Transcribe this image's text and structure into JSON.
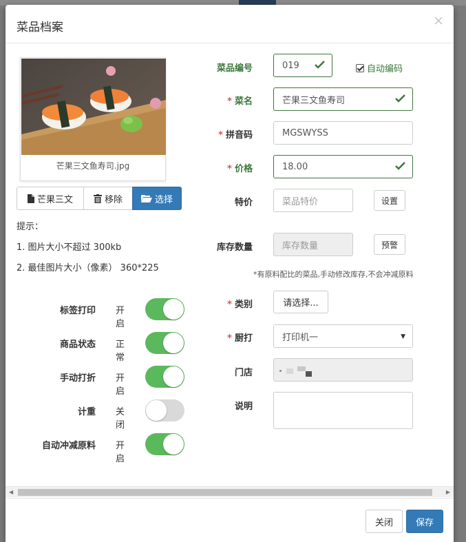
{
  "modal": {
    "title": "菜品档案",
    "close_symbol": "×"
  },
  "image": {
    "caption": "芒果三文鱼寿司.jpg"
  },
  "image_buttons": {
    "name_label": "芒果三文",
    "remove_label": "移除",
    "choose_label": "选择"
  },
  "tips": {
    "heading": "提示：",
    "items": [
      "1. 图片大小不超过 300kb",
      "2. 最佳图片大小（像素） 360*225"
    ]
  },
  "toggles": [
    {
      "label": "标签打印",
      "state": "开启",
      "on": true
    },
    {
      "label": "商品状态",
      "state": "正常",
      "on": true
    },
    {
      "label": "手动打折",
      "state": "开启",
      "on": true
    },
    {
      "label": "计重",
      "state": "关闭",
      "on": false
    },
    {
      "label": "自动冲减原料",
      "state": "开启",
      "on": true
    }
  ],
  "form": {
    "code": {
      "label": "菜品编号",
      "value": "019"
    },
    "auto_code": {
      "label": "自动编码",
      "checked": true
    },
    "name": {
      "label": "菜名",
      "value": "芒果三文鱼寿司"
    },
    "pinyin": {
      "label": "拼音码",
      "value": "MGSWYSS"
    },
    "price": {
      "label": "价格",
      "value": "18.00"
    },
    "special": {
      "label": "特价",
      "placeholder": "菜品特价",
      "button": "设置"
    },
    "stock": {
      "label": "库存数量",
      "placeholder": "库存数量",
      "button": "预警"
    },
    "stock_note": "*有原料配比的菜品,手动修改库存,不会冲减原料",
    "category": {
      "label": "类别",
      "button": "请选择..."
    },
    "kitchen": {
      "label": "厨打",
      "value": "打印机一"
    },
    "store": {
      "label": "门店"
    },
    "desc": {
      "label": "说明"
    }
  },
  "required_mark": "*",
  "footer": {
    "close_label": "关闭",
    "save_label": "保存"
  },
  "colors": {
    "primary": "#337ab7",
    "success": "#3c763d",
    "toggle_on": "#5cb85c",
    "required": "#d9534f"
  }
}
